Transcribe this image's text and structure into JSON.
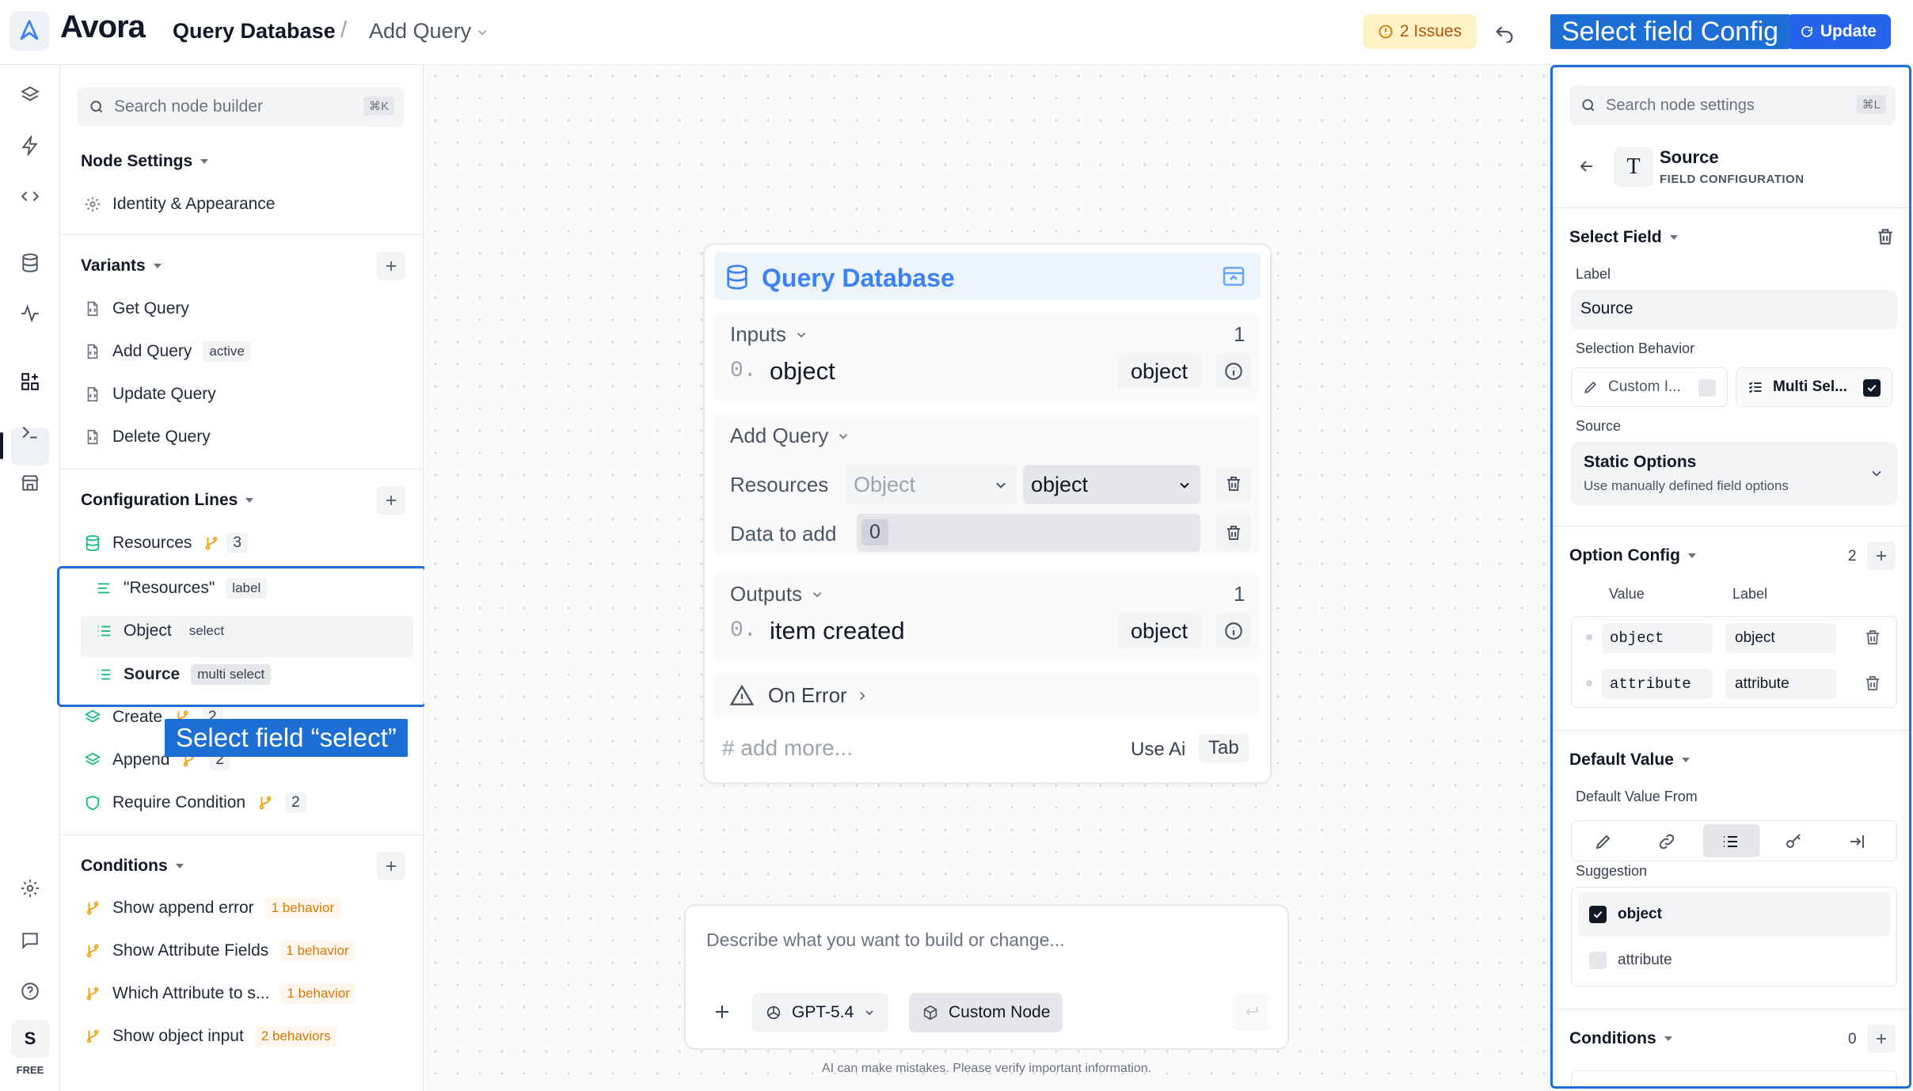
{
  "app": {
    "brand": "Avora"
  },
  "header": {
    "crumb_node": "Query Database",
    "crumb_sep": "/",
    "crumb_variant": "Add Query",
    "issues": "2 Issues",
    "update": "Update"
  },
  "annotations": {
    "top": "Select field Config",
    "left": "Select field “select”"
  },
  "rail": {
    "avatar": "S",
    "plan": "FREE"
  },
  "left": {
    "search_placeholder": "Search node builder",
    "search_kbd": "⌘K",
    "node_settings": "Node Settings",
    "identity": "Identity & Appearance",
    "variants_title": "Variants",
    "variants": [
      {
        "label": "Get Query",
        "badge": ""
      },
      {
        "label": "Add Query",
        "badge": "active"
      },
      {
        "label": "Update Query",
        "badge": ""
      },
      {
        "label": "Delete Query",
        "badge": ""
      }
    ],
    "config_title": "Configuration Lines",
    "resources": {
      "label": "Resources",
      "count": "3"
    },
    "sub_items": [
      {
        "label": "\"Resources\"",
        "tag": "label"
      },
      {
        "label": "Object",
        "tag": "select"
      },
      {
        "label": "Source",
        "tag": "multi select"
      }
    ],
    "create": {
      "label": "Create",
      "count": "2"
    },
    "append": {
      "label": "Append",
      "count": "2"
    },
    "require": {
      "label": "Require Condition",
      "count": "2"
    },
    "conditions_title": "Conditions",
    "conditions": [
      {
        "label": "Show append error",
        "badge": "1 behavior"
      },
      {
        "label": "Show Attribute Fields",
        "badge": "1 behavior"
      },
      {
        "label": "Which Attribute to s...",
        "badge": "1 behavior"
      },
      {
        "label": "Show object input",
        "badge": "2 behaviors"
      }
    ]
  },
  "node": {
    "title": "Query Database",
    "inputs_label": "Inputs",
    "inputs_count": "1",
    "input_index": "0.",
    "input_name": "object",
    "input_type": "object",
    "variant_label": "Add Query",
    "resources_label": "Resources",
    "resources_placeholder": "Object",
    "resources_value": "object",
    "data_label": "Data to add",
    "data_value": "0",
    "outputs_label": "Outputs",
    "outputs_count": "1",
    "output_index": "0.",
    "output_name": "item created",
    "output_type": "object",
    "on_error": "On Error",
    "add_more": "# add more...",
    "use_ai": "Use Ai",
    "tab": "Tab"
  },
  "prompt": {
    "placeholder": "Describe what you want to build or change...",
    "model": "GPT-5.4",
    "mode": "Custom Node",
    "disclaimer": "AI can make mistakes. Please verify important information."
  },
  "right": {
    "search_placeholder": "Search node settings",
    "search_kbd": "⌘L",
    "field_title": "Source",
    "field_sub": "FIELD CONFIGURATION",
    "select_field": "Select Field",
    "label_label": "Label",
    "label_value": "Source",
    "selection_behavior": "Selection Behavior",
    "opt_custom": "Custom I...",
    "opt_multi": "Multi Sel...",
    "source_label": "Source",
    "source_title": "Static Options",
    "source_desc": "Use manually defined field options",
    "option_config": "Option Config",
    "option_count": "2",
    "col_value": "Value",
    "col_label": "Label",
    "options": [
      {
        "value": "object",
        "label": "object"
      },
      {
        "value": "attribute",
        "label": "attribute"
      }
    ],
    "default_value": "Default Value",
    "default_from": "Default Value From",
    "suggestion": "Suggestion",
    "suggestions": [
      {
        "label": "object",
        "checked": true
      },
      {
        "label": "attribute",
        "checked": false
      }
    ],
    "conditions": "Conditions",
    "conditions_count": "0"
  }
}
